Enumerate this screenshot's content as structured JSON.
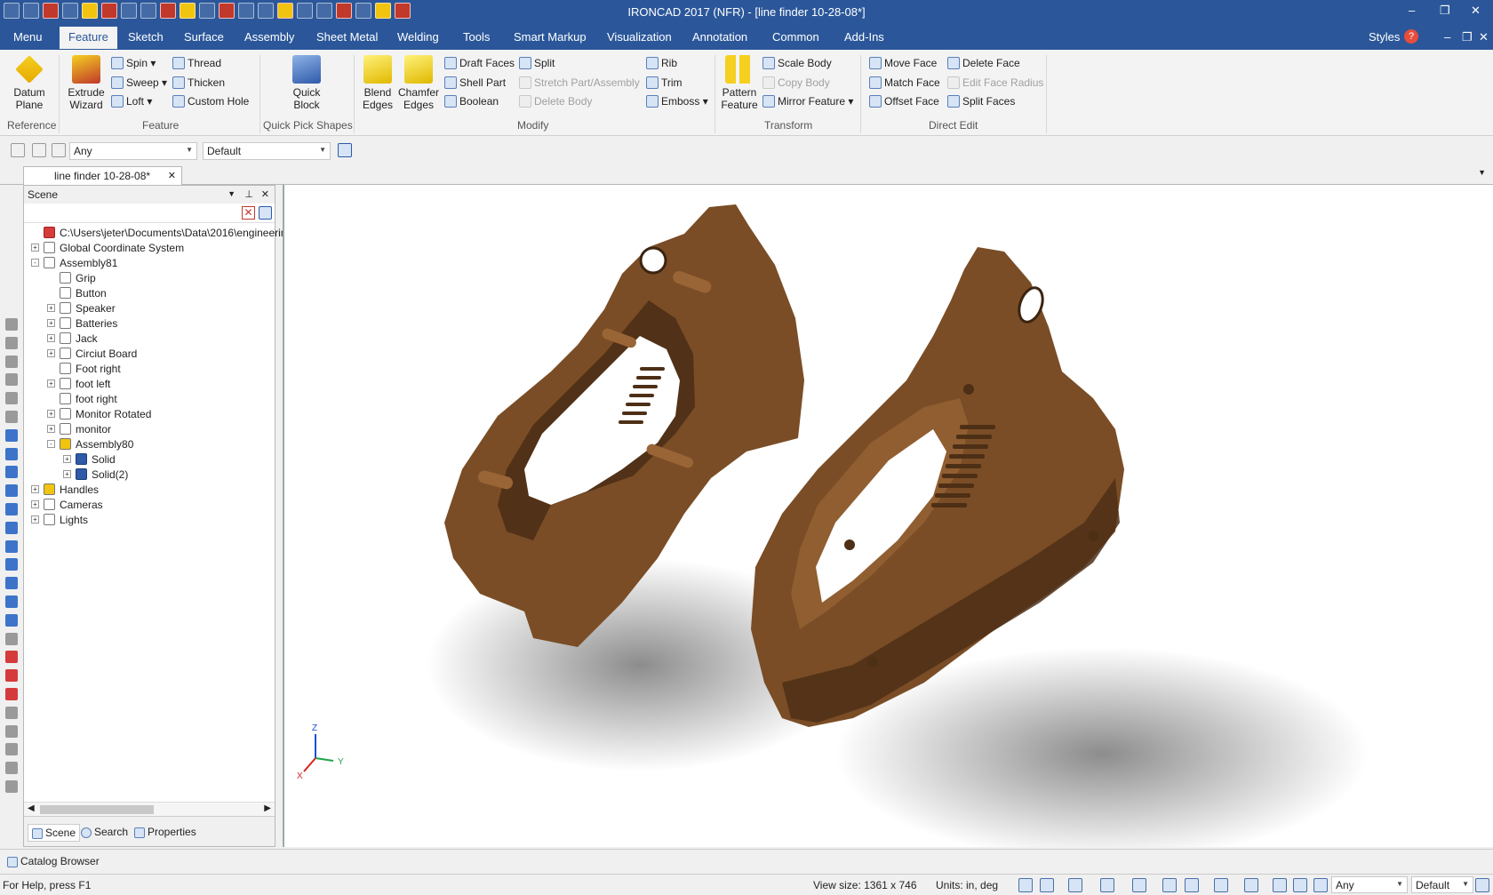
{
  "window": {
    "title": "IRONCAD 2017 (NFR) - [line finder 10-28-08*]",
    "quick_access_icons": [
      "app-icon",
      "new-icon",
      "open-icon",
      "close-icon",
      "close-all-icon",
      "print-icon",
      "folder-icon",
      "save-icon",
      "edit-icon",
      "settings-icon",
      "export-icon",
      "undo-icon",
      "redo-icon",
      "part-icon",
      "assembly-icon",
      "table-icon",
      "copy-icon",
      "help-icon",
      "graduate-icon",
      "line-icon",
      "more-icon"
    ],
    "controls": {
      "minimize": "–",
      "restore": "❐",
      "close": "✕"
    },
    "doc_controls": {
      "minimize": "–",
      "restore": "❐",
      "close": "✕"
    }
  },
  "tabs": [
    "Menu",
    "Feature",
    "Sketch",
    "Surface",
    "Assembly",
    "Sheet Metal",
    "Welding",
    "Tools",
    "Smart Markup",
    "Visualization",
    "Annotation",
    "Common",
    "Add-Ins"
  ],
  "active_tab": "Feature",
  "tabs_right": {
    "styles": "Styles",
    "help": "?"
  },
  "ribbon": {
    "reference": {
      "datum_plane_1": "Datum",
      "datum_plane_2": "Plane",
      "group": "Reference"
    },
    "feature": {
      "extrude_1": "Extrude",
      "extrude_2": "Wizard",
      "spin": "Spin",
      "sweep": "Sweep",
      "loft": "Loft",
      "thread": "Thread",
      "thicken": "Thicken",
      "custom_hole": "Custom Hole",
      "group": "Feature"
    },
    "quick_pick": {
      "quick_1": "Quick",
      "quick_2": "Block",
      "group": "Quick Pick Shapes"
    },
    "modify": {
      "blend_1": "Blend",
      "blend_2": "Edges",
      "chamfer_1": "Chamfer",
      "chamfer_2": "Edges",
      "draft_faces": "Draft Faces",
      "shell_part": "Shell Part",
      "boolean": "Boolean",
      "split": "Split",
      "stretch": "Stretch Part/Assembly",
      "delete_body": "Delete Body",
      "rib": "Rib",
      "trim": "Trim",
      "emboss": "Emboss",
      "group": "Modify"
    },
    "transform": {
      "pattern_1": "Pattern",
      "pattern_2": "Feature",
      "scale_body": "Scale Body",
      "copy_body": "Copy Body",
      "mirror_feature": "Mirror Feature",
      "group": "Transform"
    },
    "direct_edit": {
      "move_face": "Move Face",
      "match_face": "Match Face",
      "offset_face": "Offset Face",
      "delete_face": "Delete Face",
      "edit_face_radius": "Edit Face Radius",
      "split_faces": "Split Faces",
      "group": "Direct Edit"
    }
  },
  "toolbar2": {
    "filter": "Any",
    "style": "Default"
  },
  "document_tab": "line finder 10-28-08*",
  "scene": {
    "title": "Scene",
    "tree": [
      {
        "label": "C:\\Users\\jeter\\Documents\\Data\\2016\\engineerin",
        "level": 0,
        "exp": ""
      },
      {
        "label": "Global Coordinate System",
        "level": 0,
        "exp": "+"
      },
      {
        "label": "Assembly81",
        "level": 0,
        "exp": "-"
      },
      {
        "label": "Grip",
        "level": 1,
        "exp": ""
      },
      {
        "label": "Button",
        "level": 1,
        "exp": ""
      },
      {
        "label": "Speaker",
        "level": 1,
        "exp": "+"
      },
      {
        "label": "Batteries",
        "level": 1,
        "exp": "+"
      },
      {
        "label": "Jack",
        "level": 1,
        "exp": "+"
      },
      {
        "label": "Circiut Board",
        "level": 1,
        "exp": "+"
      },
      {
        "label": "Foot right",
        "level": 1,
        "exp": ""
      },
      {
        "label": "foot left",
        "level": 1,
        "exp": "+"
      },
      {
        "label": "foot right",
        "level": 1,
        "exp": ""
      },
      {
        "label": "Monitor Rotated",
        "level": 1,
        "exp": "+"
      },
      {
        "label": "monitor",
        "level": 1,
        "exp": "+"
      },
      {
        "label": "Assembly80",
        "level": 1,
        "exp": "-"
      },
      {
        "label": "Solid",
        "level": 2,
        "exp": "+"
      },
      {
        "label": "Solid(2)",
        "level": 2,
        "exp": "+"
      },
      {
        "label": "Handles",
        "level": 0,
        "exp": "+"
      },
      {
        "label": "Cameras",
        "level": 0,
        "exp": "+"
      },
      {
        "label": "Lights",
        "level": 0,
        "exp": "+"
      }
    ],
    "bottom_tabs": [
      "Scene",
      "Search",
      "Properties"
    ]
  },
  "viewport": {
    "axes": {
      "x": "X",
      "y": "Y",
      "z": "Z"
    },
    "colors": {
      "part": "#7a4d26",
      "part_light": "#9a6536",
      "part_dark": "#4d2f16"
    }
  },
  "catalog": "Catalog Browser",
  "status": {
    "help": "For Help, press F1",
    "view_size": "View size: 1361 x 746",
    "units": "Units: in, deg",
    "filter": "Any",
    "style": "Default"
  }
}
